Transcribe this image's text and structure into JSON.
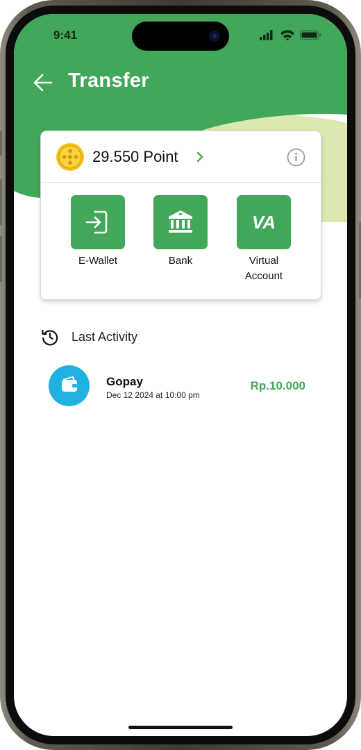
{
  "status_bar": {
    "time": "9:41"
  },
  "header": {
    "title": "Transfer"
  },
  "wallet": {
    "points": "29.550 Point"
  },
  "actions": [
    {
      "label": "E-Wallet"
    },
    {
      "label": "Bank"
    },
    {
      "label": "Virtual\nAccount",
      "tile_text": "VA"
    }
  ],
  "last_activity": {
    "title": "Last Activity",
    "items": [
      {
        "name": "Gopay",
        "date": "Dec 12 2024 at 10:00 pm",
        "amount": "Rp.10.000"
      }
    ]
  },
  "colors": {
    "primary": "#43a75a",
    "accent_light": "#dbe8b0",
    "avatar": "#1fb2e0",
    "coin": "#f2c21a"
  },
  "icons": [
    "back-arrow-icon",
    "coin-icon",
    "chevron-right-icon",
    "info-icon",
    "ewallet-login-icon",
    "bank-icon",
    "history-icon",
    "wallet-icon"
  ]
}
